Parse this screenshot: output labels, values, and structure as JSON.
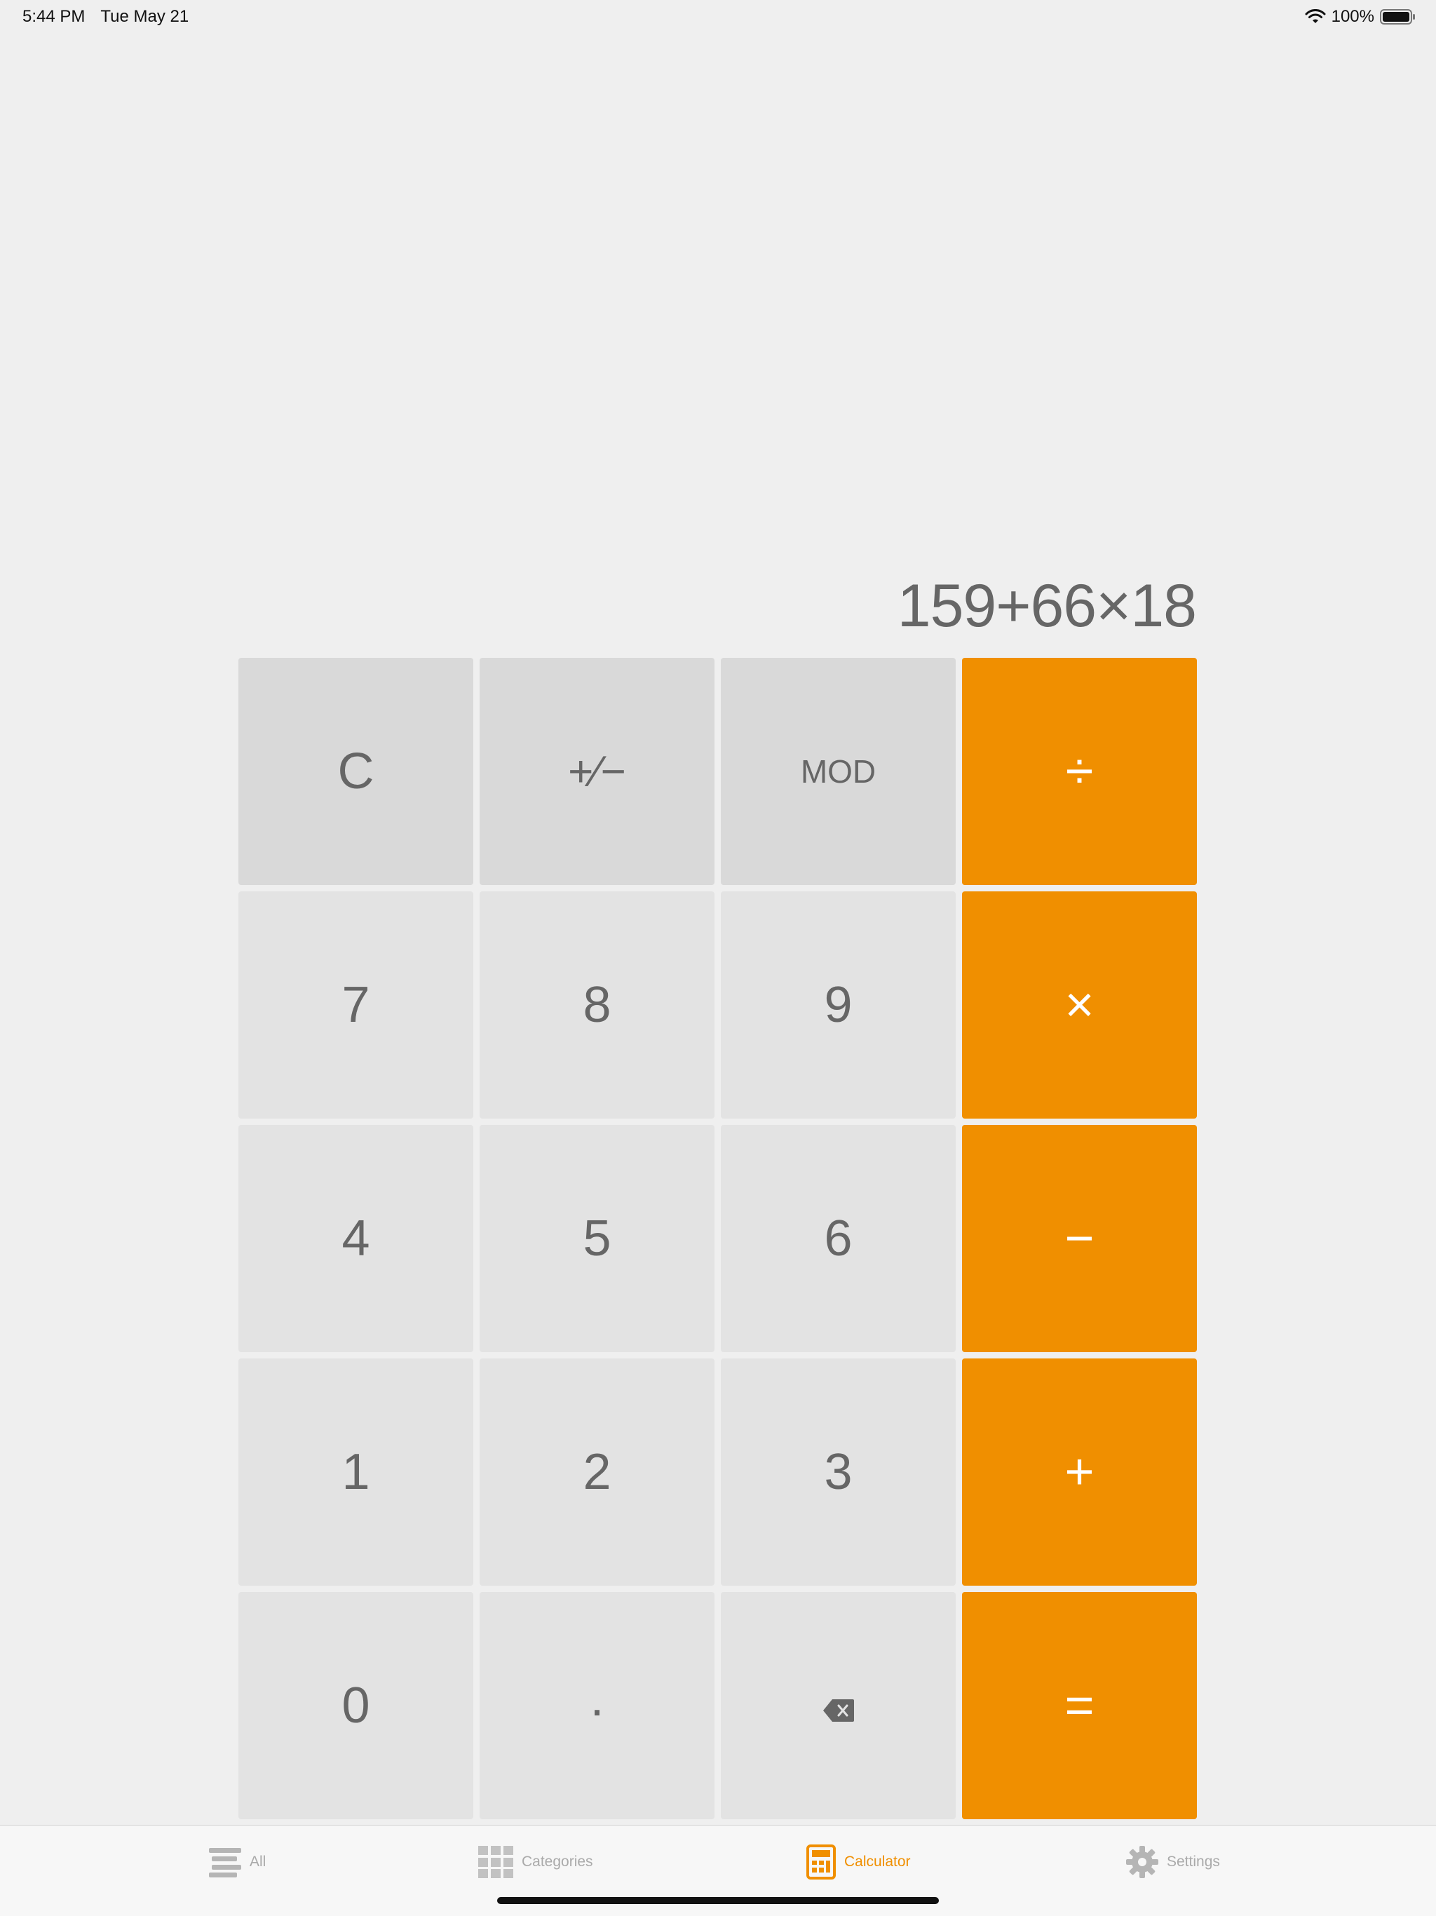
{
  "status_bar": {
    "time": "5:44 PM",
    "date": "Tue May 21",
    "battery": "100%"
  },
  "display": {
    "expression": "159+66×18"
  },
  "keypad": {
    "keys": [
      {
        "label": "C",
        "type": "fn"
      },
      {
        "label": "+∕−",
        "type": "fn"
      },
      {
        "label": "MOD",
        "type": "fn"
      },
      {
        "label": "÷",
        "type": "op"
      },
      {
        "label": "7",
        "type": "num"
      },
      {
        "label": "8",
        "type": "num"
      },
      {
        "label": "9",
        "type": "num"
      },
      {
        "label": "×",
        "type": "op"
      },
      {
        "label": "4",
        "type": "num"
      },
      {
        "label": "5",
        "type": "num"
      },
      {
        "label": "6",
        "type": "num"
      },
      {
        "label": "−",
        "type": "op"
      },
      {
        "label": "1",
        "type": "num"
      },
      {
        "label": "2",
        "type": "num"
      },
      {
        "label": "3",
        "type": "num"
      },
      {
        "label": "+",
        "type": "op"
      },
      {
        "label": "0",
        "type": "num"
      },
      {
        "label": ".",
        "type": "num"
      },
      {
        "label": "",
        "type": "num",
        "icon": "backspace-icon"
      },
      {
        "label": "=",
        "type": "op"
      }
    ]
  },
  "tab_bar": {
    "tabs": [
      {
        "label": "All",
        "icon": "list-icon",
        "active": false
      },
      {
        "label": "Categories",
        "icon": "grid-icon",
        "active": false
      },
      {
        "label": "Calculator",
        "icon": "calculator-icon",
        "active": true
      },
      {
        "label": "Settings",
        "icon": "gear-icon",
        "active": false
      }
    ]
  },
  "colors": {
    "accent": "#f08f00",
    "background": "#efefef",
    "key_number": "#e3e3e3",
    "key_function": "#d9d9d9",
    "text": "#666666"
  }
}
